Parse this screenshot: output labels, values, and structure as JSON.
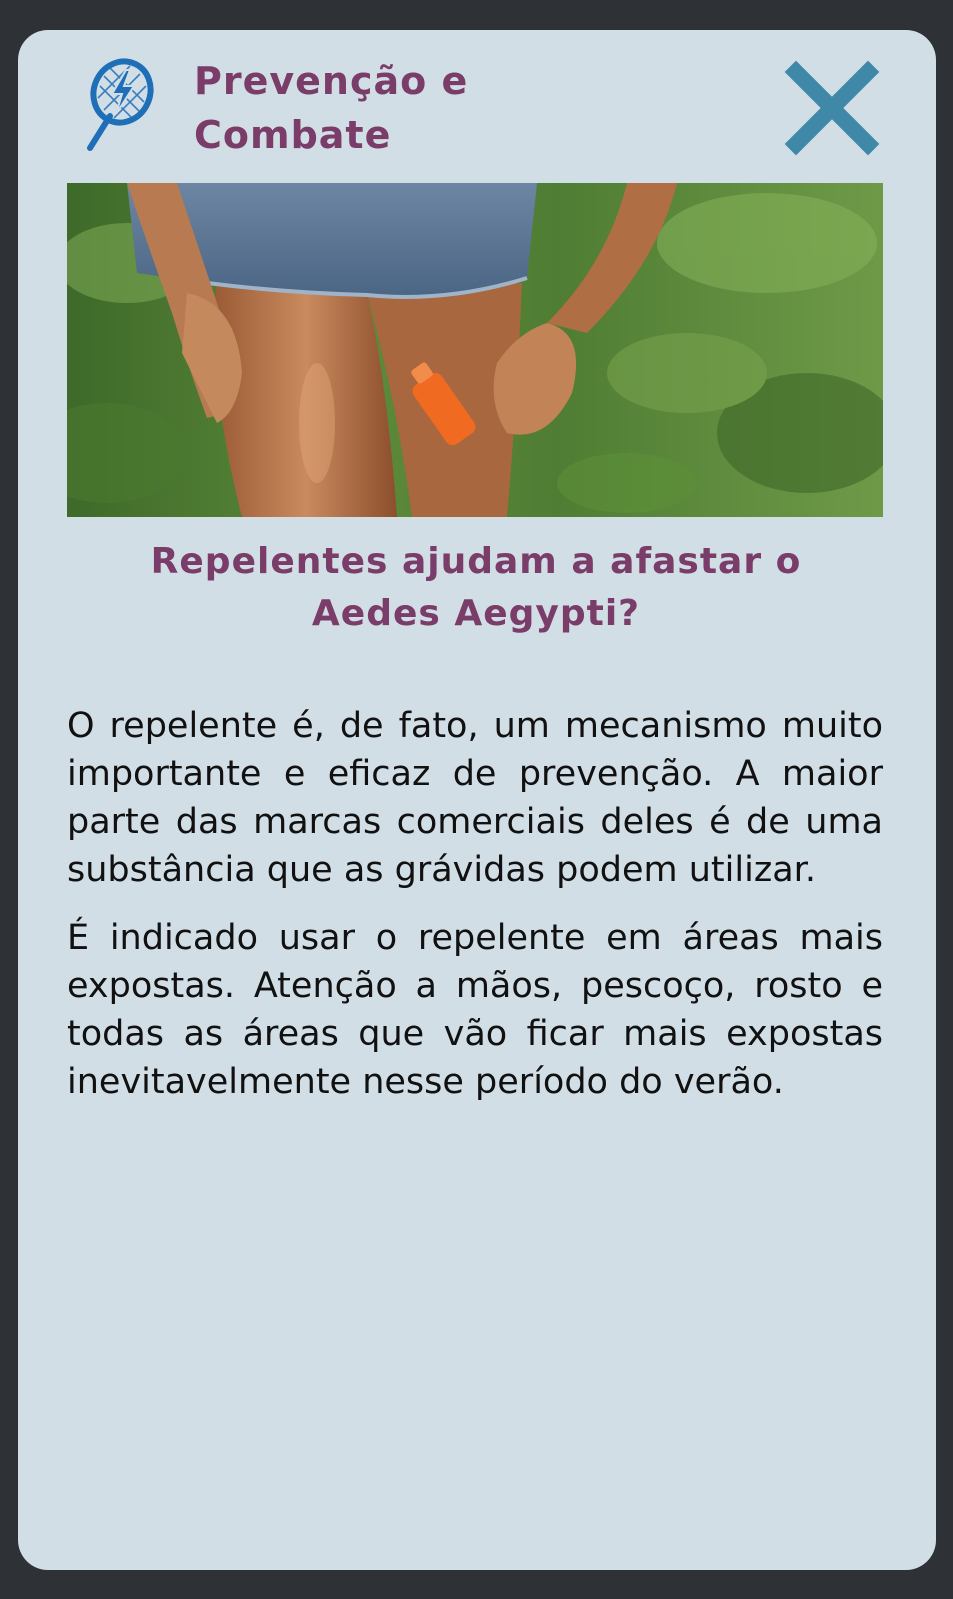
{
  "header": {
    "title_line1": "Prevenção e",
    "title_line2": "Combate",
    "logo_icon": "racket-lightning-icon",
    "close_icon": "close-icon"
  },
  "hero": {
    "image": "repellent-spray-photo"
  },
  "article": {
    "question_line1": "Repelentes ajudam a afastar o",
    "question_line2": "Aedes Aegypti?",
    "paragraphs": [
      "O repelente é, de fato, um mecanismo muito importante e eficaz de prevenção. A maior parte das marcas comerciais deles é de uma substância que as grávidas podem utilizar.",
      "É indicado usar o repelente em áreas mais expostas. Atenção a mãos, pescoço, rosto e todas as áreas que vão ficar mais expostas inevitavelmente nesse período do verão."
    ]
  },
  "colors": {
    "frame": "#2e3236",
    "card": "#d2dee6",
    "title": "#7a3c68",
    "accent": "#3f88a8",
    "icon": "#1f6fb8"
  }
}
